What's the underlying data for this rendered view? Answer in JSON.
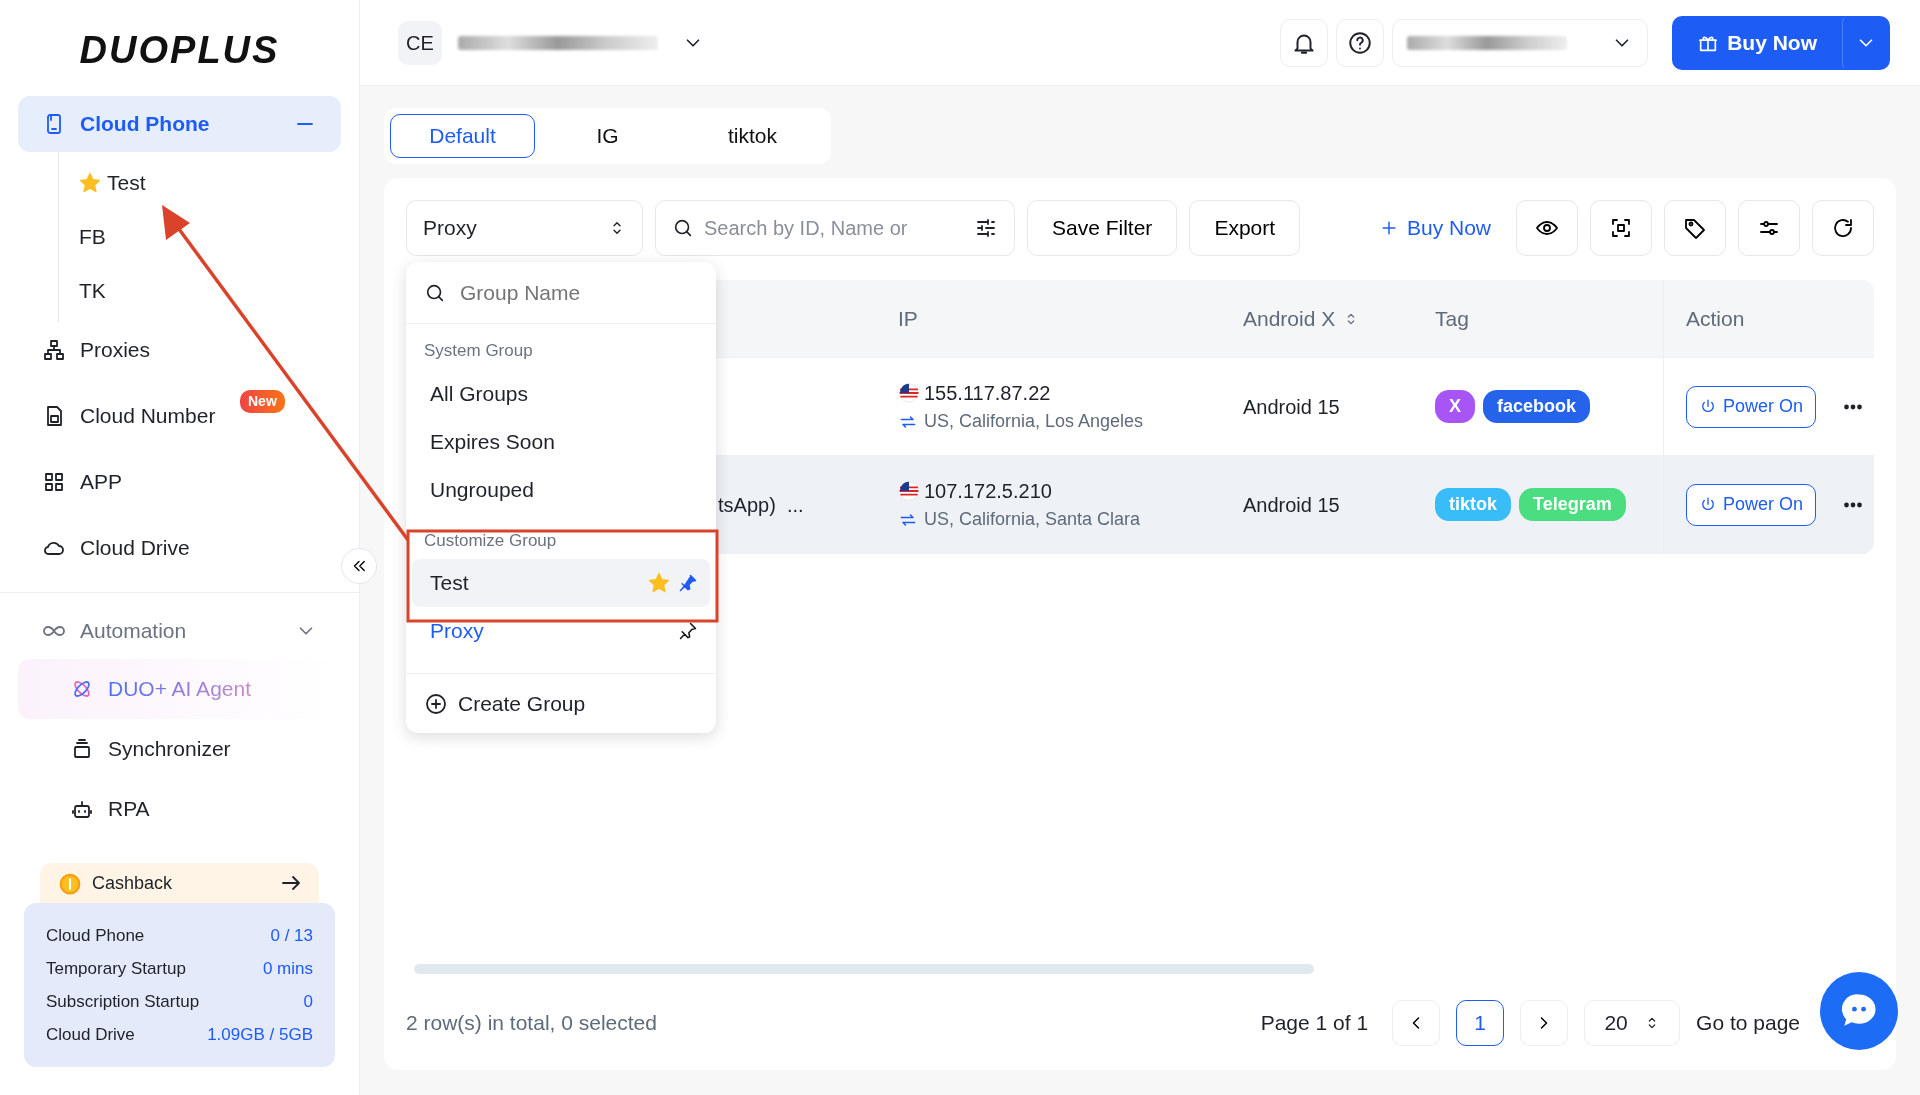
{
  "logo": "DUOPLUS",
  "sidebar": {
    "items": [
      {
        "label": "Cloud Phone",
        "selected": true,
        "expanded": true,
        "children": [
          {
            "label": "Test",
            "starred": true
          },
          {
            "label": "FB",
            "starred": false
          },
          {
            "label": "TK",
            "starred": false
          }
        ]
      },
      {
        "label": "Proxies",
        "selected": false
      },
      {
        "label": "Cloud Number",
        "selected": false,
        "badge": "New"
      },
      {
        "label": "APP",
        "selected": false
      },
      {
        "label": "Cloud Drive",
        "selected": false
      }
    ],
    "automation": {
      "label": "Automation",
      "expanded": true,
      "items": [
        {
          "label": "DUO+ AI Agent",
          "selected": true
        },
        {
          "label": "Synchronizer",
          "selected": false
        },
        {
          "label": "RPA",
          "selected": false
        }
      ]
    },
    "cashback": "Cashback",
    "stats": [
      {
        "label": "Cloud Phone",
        "value": "0 / 13"
      },
      {
        "label": "Temporary Startup",
        "value": "0 mins"
      },
      {
        "label": "Subscription Startup",
        "value": "0"
      },
      {
        "label": "Cloud Drive",
        "value": "1.09GB / 5GB"
      }
    ]
  },
  "topbar": {
    "avatar": "CE",
    "buy_button": "Buy Now"
  },
  "tabs": [
    {
      "label": "Default",
      "selected": true
    },
    {
      "label": "IG",
      "selected": false
    },
    {
      "label": "tiktok",
      "selected": false
    }
  ],
  "toolbar": {
    "group_select": "Proxy",
    "search": {
      "placeholder": "Search by ID, Name or"
    },
    "buttons": [
      "Save Filter",
      "Export"
    ],
    "buy_link": "Buy Now"
  },
  "dropdown": {
    "search": {
      "placeholder": "Group Name"
    },
    "sections": [
      {
        "title": "System Group",
        "items": [
          {
            "label": "All Groups",
            "selected": false,
            "highlighted": false
          },
          {
            "label": "Expires Soon",
            "selected": false,
            "highlighted": false
          },
          {
            "label": "Ungrouped",
            "selected": false,
            "highlighted": false
          }
        ]
      },
      {
        "title": "Customize Group",
        "items": [
          {
            "label": "Test",
            "selected": false,
            "highlighted": true,
            "starred": true,
            "pinned": true
          },
          {
            "label": "Proxy",
            "selected": true,
            "highlighted": false,
            "starred": false,
            "pinned": false
          }
        ]
      }
    ],
    "create": "Create Group"
  },
  "table": {
    "columns": [
      {
        "label": "IP",
        "sortable": false
      },
      {
        "label": "Android X",
        "sortable": true
      },
      {
        "label": "Tag",
        "sortable": false
      },
      {
        "label": "Action",
        "sortable": false
      }
    ],
    "rows": [
      {
        "column_1": "",
        "ip": "155.117.87.22",
        "location": "US, California, Los Angeles",
        "android": "Android 15",
        "highlighted": false,
        "tags": [
          {
            "label": "X",
            "color": "#a855f7"
          },
          {
            "label": "facebook",
            "color": "#2563eb"
          }
        ],
        "action": "Power On"
      },
      {
        "column_1": "tsApp)  ...",
        "ip": "107.172.5.210",
        "location": "US, California, Santa Clara",
        "android": "Android 15",
        "highlighted": true,
        "tags": [
          {
            "label": "tiktok",
            "color": "#38bdf8"
          },
          {
            "label": "Telegram",
            "color": "#4ade80"
          }
        ],
        "action": "Power On"
      }
    ]
  },
  "footer": {
    "summary": "2 row(s) in total, 0 selected",
    "page_info": "Page 1 of 1",
    "pages": [
      {
        "label": "1",
        "selected": true
      }
    ],
    "page_size": "20",
    "goto": "Go to page"
  }
}
